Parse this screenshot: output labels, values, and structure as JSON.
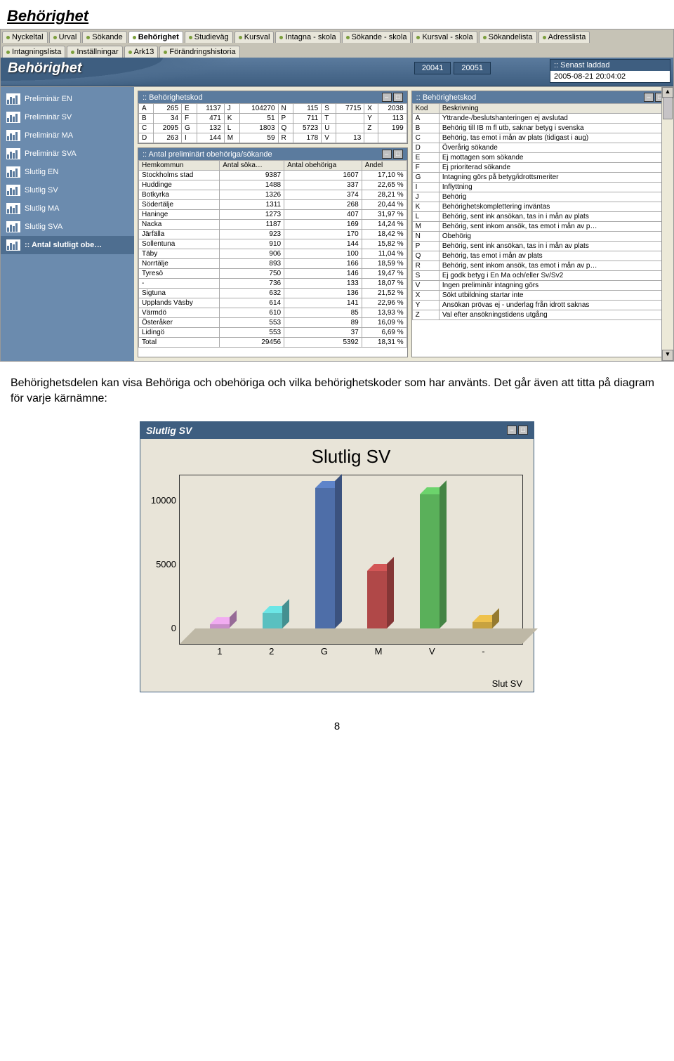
{
  "doc_heading": "Behörighet",
  "tabs_row1": [
    "Nyckeltal",
    "Urval",
    "Sökande",
    "Behörighet",
    "Studieväg",
    "Kursval",
    "Intagna - skola",
    "Sökande - skola",
    "Kursval - skola",
    "Sökandelista",
    "Adresslista"
  ],
  "tabs_row2": [
    "Intagningslista",
    "Inställningar",
    "Ark13",
    "Förändringshistoria"
  ],
  "active_tab_index": 3,
  "banner_title": "Behörighet",
  "year_buttons": [
    "20041",
    "20051"
  ],
  "loaded": {
    "label": ":: Senast laddad",
    "value": "2005-08-21 20:04:02"
  },
  "sidebar": [
    "Preliminär EN",
    "Preliminär SV",
    "Preliminär MA",
    "Preliminär SVA",
    "Slutlig EN",
    "Slutlig SV",
    "Slutlig MA",
    "Slutlig SVA",
    ":: Antal slutligt obe…"
  ],
  "sidebar_active": 8,
  "panel_bkod": {
    "title": ":: Behörighetskod",
    "rows": [
      [
        "A",
        "265",
        "E",
        "1137",
        "J",
        "104270",
        "N",
        "115",
        "S",
        "7715",
        "X",
        "2038"
      ],
      [
        "B",
        "34",
        "F",
        "471",
        "K",
        "51",
        "P",
        "711",
        "T",
        "",
        "Y",
        "113"
      ],
      [
        "C",
        "2095",
        "G",
        "132",
        "L",
        "1803",
        "Q",
        "5723",
        "U",
        "",
        "Z",
        "199"
      ],
      [
        "D",
        "263",
        "I",
        "144",
        "M",
        "59",
        "R",
        "178",
        "V",
        "13",
        "",
        ""
      ]
    ]
  },
  "panel_obehor": {
    "title": ":: Antal preliminärt obehöriga/sökande",
    "headers": [
      "Hemkommun",
      "Antal söka…",
      "Antal obehöriga",
      "Andel"
    ],
    "rows": [
      [
        "Stockholms stad",
        "9387",
        "1607",
        "17,10 %"
      ],
      [
        "Huddinge",
        "1488",
        "337",
        "22,65 %"
      ],
      [
        "Botkyrka",
        "1326",
        "374",
        "28,21 %"
      ],
      [
        "Södertälje",
        "1311",
        "268",
        "20,44 %"
      ],
      [
        "Haninge",
        "1273",
        "407",
        "31,97 %"
      ],
      [
        "Nacka",
        "1187",
        "169",
        "14,24 %"
      ],
      [
        "Järfälla",
        "923",
        "170",
        "18,42 %"
      ],
      [
        "Sollentuna",
        "910",
        "144",
        "15,82 %"
      ],
      [
        "Täby",
        "906",
        "100",
        "11,04 %"
      ],
      [
        "Norrtälje",
        "893",
        "166",
        "18,59 %"
      ],
      [
        "Tyresö",
        "750",
        "146",
        "19,47 %"
      ],
      [
        "-",
        "736",
        "133",
        "18,07 %"
      ],
      [
        "Sigtuna",
        "632",
        "136",
        "21,52 %"
      ],
      [
        "Upplands Väsby",
        "614",
        "141",
        "22,96 %"
      ],
      [
        "Värmdö",
        "610",
        "85",
        "13,93 %"
      ],
      [
        "Österåker",
        "553",
        "89",
        "16,09 %"
      ],
      [
        "Lidingö",
        "553",
        "37",
        "6,69 %"
      ],
      [
        "Total",
        "29456",
        "5392",
        "18,31 %"
      ]
    ]
  },
  "panel_desc": {
    "title": ":: Behörighetskod",
    "headers": [
      "Kod",
      "Beskrivning"
    ],
    "rows": [
      [
        "A",
        "Yttrande-/beslutshanteringen ej avslutad"
      ],
      [
        "B",
        "Behörig till IB m fl utb, saknar betyg i svenska"
      ],
      [
        "C",
        "Behörig, tas emot i mån av plats (tidigast i aug)"
      ],
      [
        "D",
        "Överårig sökande"
      ],
      [
        "E",
        "Ej mottagen som sökande"
      ],
      [
        "F",
        "Ej prioriterad sökande"
      ],
      [
        "G",
        "Intagning görs på betyg/idrottsmeriter"
      ],
      [
        "I",
        "Inflyttning"
      ],
      [
        "J",
        "Behörig"
      ],
      [
        "K",
        "Behörighetskomplettering inväntas"
      ],
      [
        "L",
        "Behörig, sent ink ansökan, tas in i mån av plats"
      ],
      [
        "M",
        "Behörig, sent inkom ansök, tas emot i mån av p…"
      ],
      [
        "N",
        "Obehörig"
      ],
      [
        "P",
        "Behörig, sent ink ansökan, tas in i mån av plats"
      ],
      [
        "Q",
        "Behörig, tas emot i mån av plats"
      ],
      [
        "R",
        "Behörig, sent inkom ansök, tas emot i mån av p…"
      ],
      [
        "S",
        "Ej godk betyg i En Ma och/eller Sv/Sv2"
      ],
      [
        "V",
        "Ingen preliminär intagning görs"
      ],
      [
        "X",
        "Sökt utbildning startar inte"
      ],
      [
        "Y",
        "Ansökan prövas ej - underlag från idrott saknas"
      ],
      [
        "Z",
        "Val efter ansökningstidens utgång"
      ]
    ]
  },
  "body_text": "Behörighetsdelen kan visa Behöriga och obehöriga och vilka behörighetskoder som har använts. Det går även att titta på diagram för varje kärnämne:",
  "chartwin_title": "Slutlig SV",
  "chart_data": {
    "type": "bar",
    "title": "Slutlig SV",
    "categories": [
      "1",
      "2",
      "G",
      "M",
      "V",
      "-"
    ],
    "series": [
      {
        "name": "Slut SV",
        "values": [
          300,
          1200,
          11000,
          4500,
          10500,
          500
        ],
        "colors": [
          "#C98FC9",
          "#5AC0C0",
          "#4E6EA8",
          "#B04848",
          "#5AB05A",
          "#C7A23F"
        ]
      }
    ],
    "ylim": [
      0,
      12000
    ],
    "yticks": [
      0,
      5000,
      10000
    ],
    "xlabel": "",
    "ylabel": ""
  },
  "pagenum": "8"
}
